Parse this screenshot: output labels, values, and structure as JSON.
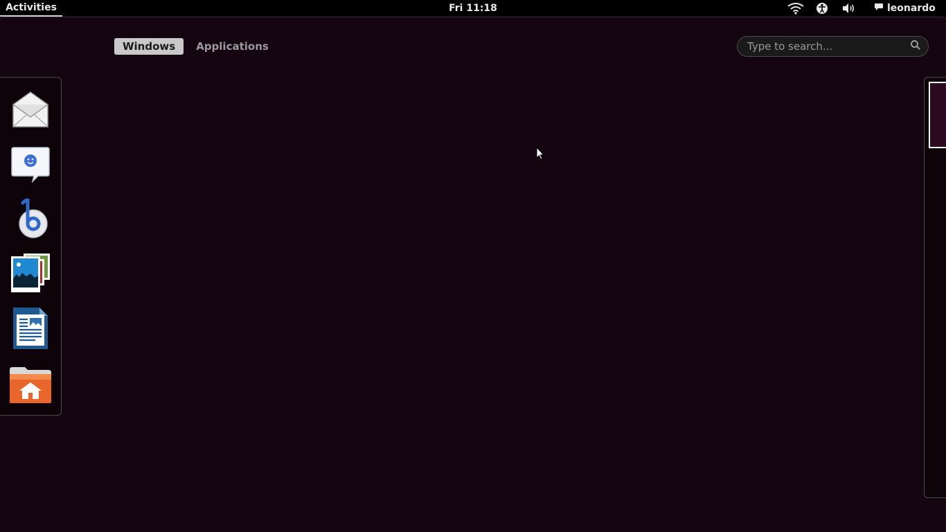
{
  "topbar": {
    "activities_label": "Activities",
    "clock": "Fri 11:18",
    "user_name": "leonardo",
    "icons": [
      "wifi-icon",
      "accessibility-icon",
      "volume-icon",
      "chat-status-icon"
    ]
  },
  "overview": {
    "tabs": [
      {
        "label": "Windows",
        "active": true
      },
      {
        "label": "Applications",
        "active": false
      }
    ],
    "search": {
      "placeholder": "Type to search...",
      "value": ""
    }
  },
  "dash": {
    "apps": [
      {
        "icon": "mail-icon"
      },
      {
        "icon": "chat-icon"
      },
      {
        "icon": "music-player-icon"
      },
      {
        "icon": "image-viewer-icon"
      },
      {
        "icon": "writer-document-icon"
      },
      {
        "icon": "home-folder-icon"
      }
    ]
  },
  "colors": {
    "background": "#150510",
    "topbar": "#000000",
    "tab_active": "#c9c9c9",
    "workspace_border": "#ffffff"
  }
}
